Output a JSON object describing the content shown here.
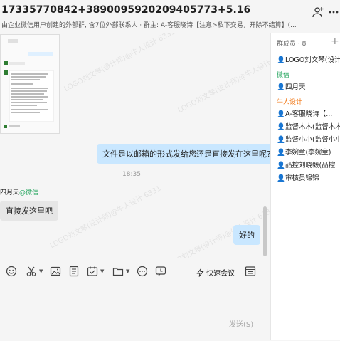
{
  "header": {
    "title": "17335770842+3890095920209405773+5.16",
    "subtitle": "由企业微信用户创建的外部群, 含7位外部联系人 · 群主: A-客服晓诗【注意>私下交易，开除不结算】(..."
  },
  "messages": {
    "outgoing_question": "文件是以邮箱的形式发给您还是直接发在这里呢?",
    "time": "18:35",
    "sender_name": "四月天",
    "sender_tag": "@微信",
    "incoming_reply": "直接发这里吧",
    "outgoing_ok": "好的"
  },
  "composer": {
    "quick_meeting": "快速会议",
    "send_label": "发送(S)"
  },
  "sidebar": {
    "members_header": "群成员 · 8",
    "add_symbol": "+",
    "members": [
      {
        "label": "LOGO刘文琴(设计",
        "icon_color": "#f2a04a"
      },
      {
        "section": "微信"
      },
      {
        "label": "四月天",
        "icon_color": "#f2a04a"
      },
      {
        "section": "牛人设计"
      },
      {
        "label": "A-客服晓诗【...",
        "icon_color": "#3a6fd8"
      },
      {
        "label": "监督木木(监督木木",
        "icon_color": "#3a6fd8"
      },
      {
        "label": "监督小小(监督小小",
        "icon_color": "#3a6fd8"
      },
      {
        "label": "李婉童(李婉童)",
        "icon_color": "#3a6fd8"
      },
      {
        "label": "品控刘晓毅(品控",
        "icon_color": "#3a6fd8"
      },
      {
        "label": "审核员锦锦",
        "icon_color": "#3a6fd8"
      }
    ],
    "section_wechat": "微信",
    "section_niuren": "牛人设计",
    "m0": "LOGO刘文琴(设计",
    "m1": "四月天",
    "m2": "A-客服晓诗【...",
    "m3": "监督木木(监督木木",
    "m4": "监督小小(监督小小",
    "m5": "李婉童(李婉童)",
    "m6": "品控刘晓毅(品控",
    "m7": "审核员锦锦"
  },
  "watermark": "LOGO刘文琴(设计师)@牛人设计 6331"
}
